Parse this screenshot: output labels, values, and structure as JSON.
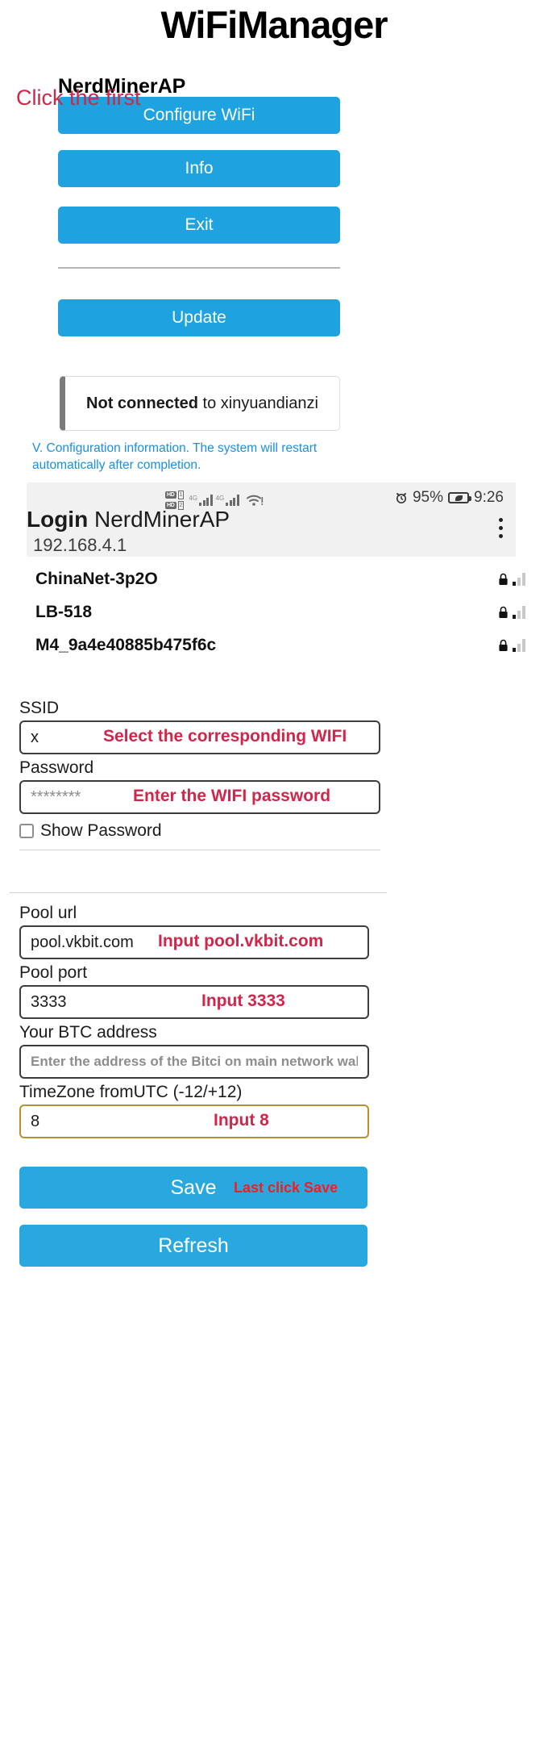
{
  "wifimanager": {
    "title": "WiFiManager",
    "ap_name": "NerdMinerAP",
    "buttons": {
      "configure_wifi": "Configure WiFi",
      "info": "Info",
      "exit": "Exit",
      "update": "Update"
    },
    "status": {
      "bold": "Not connected",
      "rest": " to xinyuandianzi"
    },
    "annotation_click_first": "Click the first",
    "blue_note": "V. Configuration information. The system will restart automatically after completion."
  },
  "phone": {
    "statusbar": {
      "hd_badge_1": "HD",
      "hd_badge_2": "HD",
      "sim_1": "1",
      "sim_2": "2",
      "net_1": "4G",
      "net_2": "4G",
      "battery_percent": "95%",
      "clock": "9:26"
    },
    "browser": {
      "login_word": "Login",
      "page_title": "NerdMinerAP",
      "url": "192.168.4.1",
      "menu_icon": "kebab-menu-icon"
    }
  },
  "wifi_networks": [
    {
      "ssid": "ChinaNet-3p2O",
      "secured": true,
      "signal": 1
    },
    {
      "ssid": "LB-518",
      "secured": true,
      "signal": 1
    },
    {
      "ssid": "M4_9a4e40885b475f6c",
      "secured": true,
      "signal": 1
    }
  ],
  "form": {
    "ssid": {
      "label": "SSID",
      "value": "x",
      "hint": "Select the corresponding WIFI"
    },
    "password": {
      "label": "Password",
      "placeholder": "********",
      "hint": "Enter the WIFI password"
    },
    "show_password": {
      "label": "Show Password",
      "checked": false
    },
    "pool_url": {
      "label": "Pool url",
      "value": "pool.vkbit.com",
      "hint": "Input pool.vkbit.com"
    },
    "pool_port": {
      "label": "Pool port",
      "value": "3333",
      "hint": "Input 3333"
    },
    "btc_address": {
      "label": "Your BTC address",
      "placeholder": "Enter the address of the Bitci on main network wallet"
    },
    "timezone": {
      "label": "TimeZone fromUTC (-12/+12)",
      "value": "8",
      "hint": "Input 8"
    },
    "save_button": "Save",
    "save_hint": "Last click Save",
    "refresh_button": "Refresh"
  },
  "colors": {
    "button_blue": "#1fa2e0",
    "button_blue_lower": "#29a8e0",
    "annotation_red": "#d0264a",
    "save_hint_red": "#ef2020",
    "note_blue": "#1a8fe0",
    "timezone_border_gold": "#b8912f"
  }
}
